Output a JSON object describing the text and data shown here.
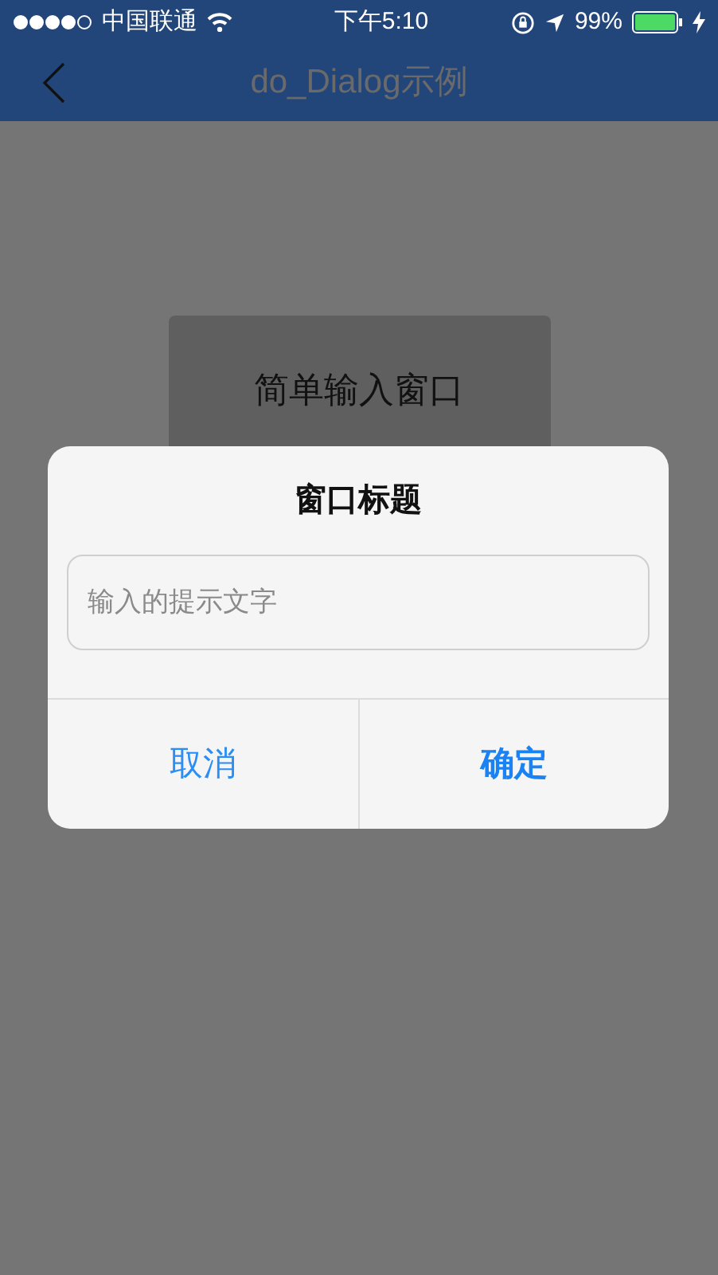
{
  "status_bar": {
    "carrier": "中国联通",
    "time": "下午5:10",
    "battery": "99%"
  },
  "nav_bar": {
    "title": "do_Dialog示例"
  },
  "buttons": [
    {
      "label": "简单输入窗口"
    }
  ],
  "dialog": {
    "title": "窗口标题",
    "input": {
      "placeholder": "输入的提示文字"
    },
    "actions": [
      {
        "label": "取消",
        "kind": "cancel"
      },
      {
        "label": "确定",
        "kind": "confirm"
      }
    ]
  }
}
